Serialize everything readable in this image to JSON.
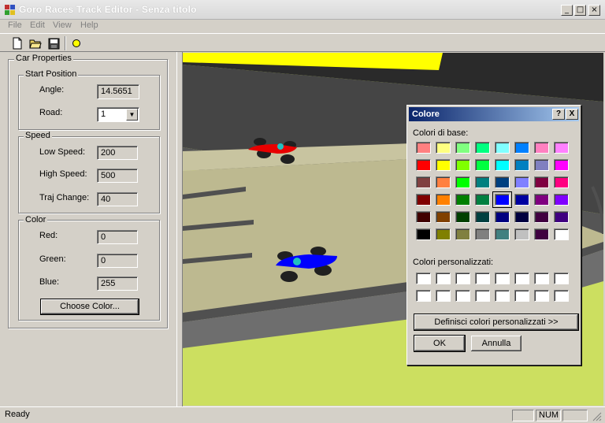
{
  "window": {
    "title": "Goro Races Track Editor - Senza titolo"
  },
  "menu": [
    "File",
    "Edit",
    "View",
    "Help"
  ],
  "toolbar": {
    "icons": [
      "new-file-icon",
      "open-folder-icon",
      "save-icon",
      "light-bulb-icon"
    ]
  },
  "car_properties": {
    "title": "Car Properties",
    "start_position": {
      "title": "Start Position",
      "angle_label": "Angle:",
      "angle_value": "14.5651",
      "road_label": "Road:",
      "road_value": "1"
    },
    "speed": {
      "title": "Speed",
      "low_label": "Low Speed:",
      "low_value": "200",
      "high_label": "High Speed:",
      "high_value": "500",
      "traj_label": "Traj Change:",
      "traj_value": "40"
    },
    "color": {
      "title": "Color",
      "red_label": "Red:",
      "red_value": "0",
      "green_label": "Green:",
      "green_value": "0",
      "blue_label": "Blue:",
      "blue_value": "255",
      "choose_button": "Choose Color..."
    }
  },
  "color_dialog": {
    "title": "Colore",
    "help_button": "?",
    "close_button": "X",
    "basic_label": "Colori di base:",
    "basic_colors": [
      "#ff8080",
      "#ffff80",
      "#80ff80",
      "#00ff80",
      "#80ffff",
      "#0080ff",
      "#ff80c0",
      "#ff80ff",
      "#ff0000",
      "#ffff00",
      "#80ff00",
      "#00ff40",
      "#00ffff",
      "#0080c0",
      "#8080c0",
      "#ff00ff",
      "#804040",
      "#ff8040",
      "#00ff00",
      "#008080",
      "#004080",
      "#8080ff",
      "#800040",
      "#ff0080",
      "#800000",
      "#ff8000",
      "#008000",
      "#008040",
      "#0000ff",
      "#0000a0",
      "#800080",
      "#8000ff",
      "#400000",
      "#804000",
      "#004000",
      "#004040",
      "#000080",
      "#000040",
      "#400040",
      "#400080",
      "#000000",
      "#808000",
      "#808040",
      "#808080",
      "#408080",
      "#c0c0c0",
      "#400040",
      "#ffffff"
    ],
    "selected_index": 28,
    "custom_label": "Colori personalizzati:",
    "custom_colors": [
      "#ffffff",
      "#ffffff",
      "#ffffff",
      "#ffffff",
      "#ffffff",
      "#ffffff",
      "#ffffff",
      "#ffffff",
      "#ffffff",
      "#ffffff",
      "#ffffff",
      "#ffffff",
      "#ffffff",
      "#ffffff",
      "#ffffff",
      "#ffffff"
    ],
    "define_button": "Definisci colori personalizzati >>",
    "ok_button": "OK",
    "cancel_button": "Annulla"
  },
  "status": {
    "text": "Ready",
    "num": "NUM"
  }
}
